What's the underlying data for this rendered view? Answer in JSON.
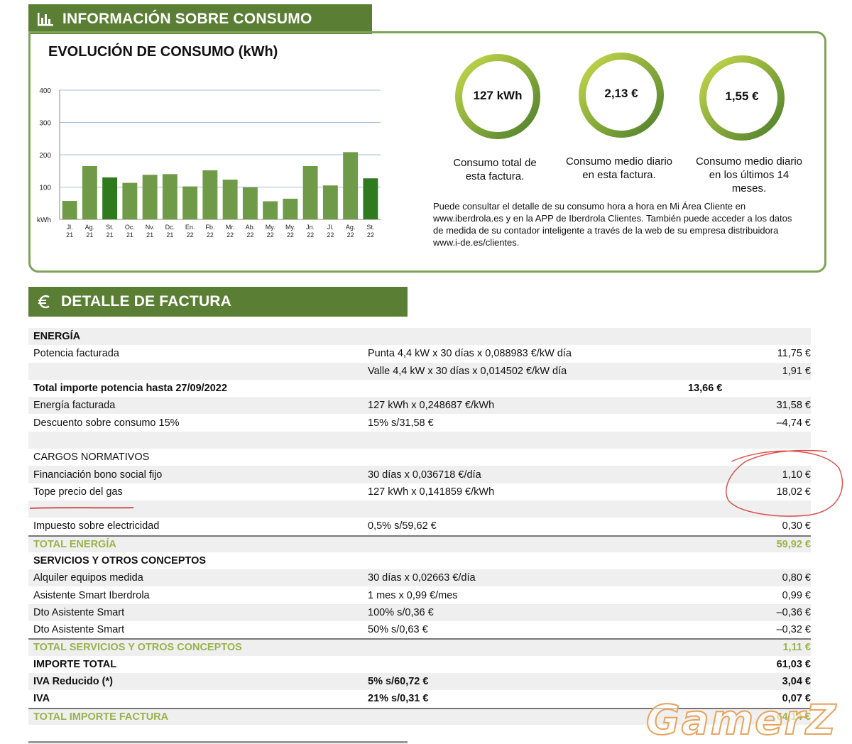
{
  "consumo": {
    "header": "INFORMACIÓN SOBRE CONSUMO",
    "header_icon": "bar-chart-icon",
    "chart_title": "EVOLUCIÓN DE CONSUMO (kWh)",
    "rings": [
      {
        "value": "127 kWh",
        "caption_l1": "Consumo total de",
        "caption_l2": "esta factura.",
        "caption_l3": ""
      },
      {
        "value": "2,13 €",
        "caption_l1": "Consumo medio diario",
        "caption_l2": "en esta factura.",
        "caption_l3": ""
      },
      {
        "value": "1,55 €",
        "caption_l1": "Consumo medio diario",
        "caption_l2": "en los últimos 14",
        "caption_l3": "meses."
      }
    ],
    "info_text": "Puede consultar el detalle de su consumo hora a hora en Mi Área Cliente en www.iberdrola.es y en la APP de Iberdrola Clientes. También puede acceder a los datos de medida de su contador inteligente a través de la web de su empresa distribuidora www.i-de.es/clientes.",
    "ring_color": "#6e9a3e"
  },
  "chart_data": {
    "type": "bar",
    "title": "EVOLUCIÓN DE CONSUMO (kWh)",
    "ylabel": "kWh",
    "ylim": [
      0,
      400
    ],
    "yticks": [
      400,
      300,
      200,
      100
    ],
    "categories": [
      [
        "Jl.",
        "21"
      ],
      [
        "Ag.",
        "21"
      ],
      [
        "St.",
        "21"
      ],
      [
        "Oc.",
        "21"
      ],
      [
        "Nv.",
        "21"
      ],
      [
        "Dc.",
        "21"
      ],
      [
        "En.",
        "22"
      ],
      [
        "Fb.",
        "22"
      ],
      [
        "Mr.",
        "22"
      ],
      [
        "Ab.",
        "22"
      ],
      [
        "My.",
        "22"
      ],
      [
        "My.",
        "22"
      ],
      [
        "Jn.",
        "22"
      ],
      [
        "Jl.",
        "22"
      ],
      [
        "Ag.",
        "22"
      ],
      [
        "St.",
        "22"
      ]
    ],
    "values": [
      57,
      165,
      130,
      113,
      138,
      140,
      102,
      152,
      123,
      99,
      56,
      64,
      165,
      105,
      208,
      127
    ],
    "highlight": [
      false,
      false,
      true,
      false,
      false,
      false,
      false,
      false,
      false,
      false,
      false,
      false,
      false,
      false,
      false,
      true
    ],
    "bar_color": "#6f9a48",
    "highlight_color": "#2f7a1f",
    "grid": true
  },
  "factura": {
    "header": "DETALLE DE FACTURA",
    "header_icon": "euro-icon",
    "rows": [
      {
        "c1": "ENERGÍA",
        "c2": "",
        "c3": "",
        "c4": "",
        "style": "bold",
        "shade": true
      },
      {
        "c1": "Potencia facturada",
        "c2": "Punta 4,4 kW x 30 días x 0,088983 €/kW día",
        "c3": "",
        "c4": "11,75 €",
        "style": "",
        "shade": false
      },
      {
        "c1": "",
        "c2": "Valle 4,4 kW x 30 días x 0,014502 €/kW día",
        "c3": "",
        "c4": "1,91 €",
        "style": "",
        "shade": true
      },
      {
        "c1": "Total importe potencia hasta 27/09/2022",
        "c2": "",
        "c3": "13,66 €",
        "c4": "",
        "style": "bold",
        "shade": false
      },
      {
        "c1": "Energía facturada",
        "c2": "127 kWh  x  0,248687 €/kWh",
        "c3": "",
        "c4": "31,58 €",
        "style": "",
        "shade": true
      },
      {
        "c1": "Descuento sobre consumo 15%",
        "c2": "15% s/31,58 €",
        "c3": "",
        "c4": "–4,74 €",
        "style": "",
        "shade": false
      },
      {
        "c1": "",
        "c2": "",
        "c3": "",
        "c4": "",
        "style": "",
        "shade": true
      },
      {
        "c1": "CARGOS NORMATIVOS",
        "c2": "",
        "c3": "",
        "c4": "",
        "style": "",
        "shade": false
      },
      {
        "c1": "Financiación bono social fijo",
        "c2": "30 días  x  0,036718 €/día",
        "c3": "",
        "c4": "1,10 €",
        "style": "",
        "shade": true
      },
      {
        "c1": "Tope precio del gas",
        "c2": "127 kWh  x  0,141859 €/kWh",
        "c3": "",
        "c4": "18,02 €",
        "style": "",
        "shade": false
      },
      {
        "c1": "",
        "c2": "",
        "c3": "",
        "c4": "",
        "style": "",
        "shade": true
      },
      {
        "c1": "Impuesto sobre electricidad",
        "c2": "0,5% s/59,62 €",
        "c3": "",
        "c4": "0,30 €",
        "style": "",
        "shade": false
      },
      {
        "c1": "TOTAL ENERGÍA",
        "c2": "",
        "c3": "",
        "c4": "59,92 €",
        "style": "total",
        "shade": true
      },
      {
        "c1": "SERVICIOS Y OTROS CONCEPTOS",
        "c2": "",
        "c3": "",
        "c4": "",
        "style": "bold",
        "shade": false
      },
      {
        "c1": "Alquiler equipos medida",
        "c2": "30 días  x  0,02663 €/día",
        "c3": "",
        "c4": "0,80 €",
        "style": "",
        "shade": true
      },
      {
        "c1": "Asistente Smart Iberdrola",
        "c2": "1 mes  x  0,99 €/mes",
        "c3": "",
        "c4": "0,99 €",
        "style": "",
        "shade": false
      },
      {
        "c1": "Dto Asistente Smart",
        "c2": "100% s/0,36 €",
        "c3": "",
        "c4": "–0,36 €",
        "style": "",
        "shade": true
      },
      {
        "c1": "Dto Asistente Smart",
        "c2": "50% s/0,63 €",
        "c3": "",
        "c4": "–0,32 €",
        "style": "",
        "shade": false
      },
      {
        "c1": "TOTAL SERVICIOS Y OTROS CONCEPTOS",
        "c2": "",
        "c3": "",
        "c4": "1,11 €",
        "style": "total",
        "shade": true
      },
      {
        "c1": "IMPORTE TOTAL",
        "c2": "",
        "c3": "",
        "c4": "61,03 €",
        "style": "bold",
        "shade": false
      },
      {
        "c1": "IVA Reducido (*)",
        "c2": "5% s/60,72 €",
        "c3": "",
        "c4": "3,04 €",
        "style": "bold",
        "shade": true
      },
      {
        "c1": "IVA",
        "c2": "21% s/0,31 €",
        "c3": "",
        "c4": "0,07 €",
        "style": "bold",
        "shade": false
      },
      {
        "c1": "TOTAL IMPORTE FACTURA",
        "c2": "",
        "c3": "",
        "c4": "64,14 €",
        "style": "total",
        "shade": true
      }
    ]
  },
  "annotation_color": "#d9534f",
  "watermark": "GamerZ"
}
